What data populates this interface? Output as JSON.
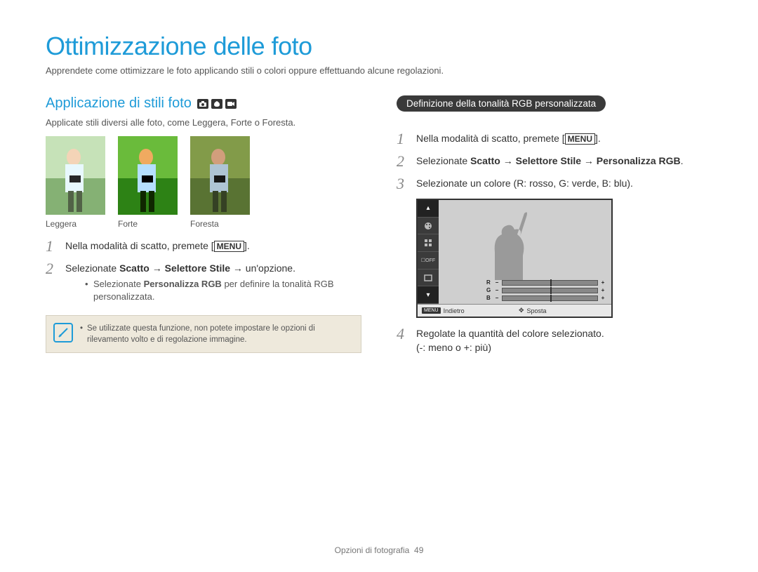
{
  "title": "Ottimizzazione delle foto",
  "intro": "Apprendete come ottimizzare le foto applicando stili o colori oppure effettuando alcune regolazioni.",
  "left": {
    "heading": "Applicazione di stili foto",
    "desc": "Applicate stili diversi alle foto, come Leggera, Forte o Foresta.",
    "thumbs": [
      "Leggera",
      "Forte",
      "Foresta"
    ],
    "steps": [
      {
        "num": "1",
        "text_pre": "Nella modalità di scatto, premete [",
        "key": "MENU",
        "text_post": "]."
      },
      {
        "num": "2",
        "text_plain": "Selezionate ",
        "bold1": "Scatto",
        "arrow1": " → ",
        "bold2": "Selettore Stile",
        "arrow2": " → ",
        "tail": "un'opzione.",
        "sub": [
          "Selezionate Personalizza RGB per definire la tonalità RGB personalizzata."
        ]
      }
    ],
    "note": "Se utilizzate questa funzione, non potete impostare le opzioni di rilevamento volto e di regolazione immagine."
  },
  "right": {
    "pill": "Definizione della tonalità RGB personalizzata",
    "steps": [
      {
        "num": "1",
        "text_pre": "Nella modalità di scatto, premete [",
        "key": "MENU",
        "text_post": "]."
      },
      {
        "num": "2",
        "text_plain": "Selezionate ",
        "bold1": "Scatto",
        "arrow1": " → ",
        "bold2": "Selettore Stile",
        "arrow2": " → ",
        "bold3": "Personalizza RGB",
        "tail": "."
      },
      {
        "num": "3",
        "text_simple": "Selezionate un colore (R: rosso, G: verde, B: blu)."
      },
      {
        "num": "4",
        "text_simple": "Regolate la quantità del colore selezionato.",
        "subtext": "(-: meno o +: più)"
      }
    ],
    "screen": {
      "channels": [
        "R",
        "G",
        "B"
      ],
      "footer_left_key": "MENU",
      "footer_left": "Indietro",
      "footer_right": "Sposta"
    }
  },
  "footer": {
    "section": "Opzioni di fotografia",
    "page": "49"
  }
}
